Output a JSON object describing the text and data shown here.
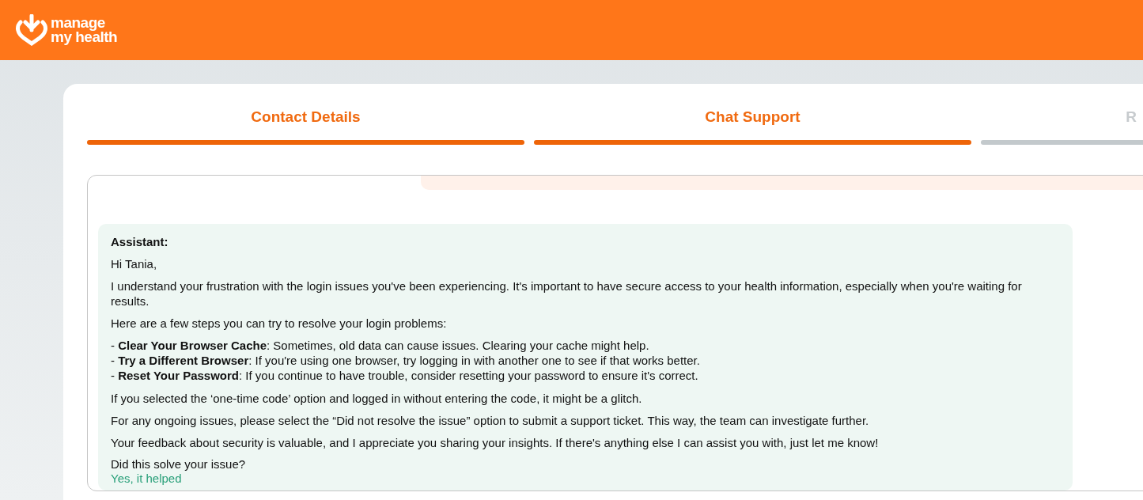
{
  "header": {
    "logo_text": [
      "manage",
      "my health"
    ]
  },
  "steps": [
    {
      "label": "Contact Details",
      "completed": true
    },
    {
      "label": "Chat Support",
      "completed": true
    },
    {
      "label": "R",
      "completed": false
    }
  ],
  "chat": {
    "message": {
      "sender": "Assistant:",
      "blocks": [
        {
          "kind": "paragraph",
          "text": "Hi Tania,"
        },
        {
          "kind": "paragraph",
          "text": "I understand your frustration with the login issues you've been experiencing. It's important to have secure access to your health information, especially when you're waiting for results."
        },
        {
          "kind": "paragraph",
          "text": "Here are a few steps you can try to resolve your login problems:"
        },
        {
          "kind": "list",
          "items": [
            "- **Clear Your Browser Cache**: Sometimes, old data can cause issues. Clearing your cache might help.",
            "- **Try a Different Browser**: If you're using one browser, try logging in with another one to see if that works better.",
            "- **Reset Your Password**: If you continue to have trouble, consider resetting your password to ensure it's correct."
          ]
        },
        {
          "kind": "paragraph",
          "text": "If you selected the ‘one-time code’ option and logged in without entering the code, it might be a glitch."
        },
        {
          "kind": "paragraph",
          "text": "For any ongoing issues, please select the “Did not resolve the issue” option to submit a support ticket. This way, the team can investigate further."
        },
        {
          "kind": "paragraph",
          "text": "Your feedback about security is valuable, and I appreciate you sharing your insights. If there's anything else I can assist you with, just let me know!"
        }
      ],
      "question": "Did this solve your issue?",
      "options": [
        "Yes, it helped"
      ]
    }
  }
}
